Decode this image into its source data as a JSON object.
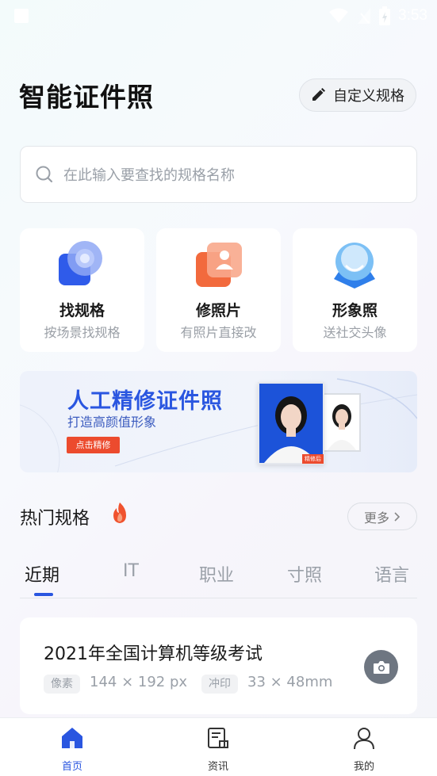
{
  "status_bar": {
    "time": "3:53"
  },
  "header": {
    "title": "智能证件照",
    "custom_button": "自定义规格"
  },
  "search": {
    "placeholder": "在此输入要查找的规格名称"
  },
  "features": [
    {
      "title": "找规格",
      "subtitle": "按场景找规格",
      "icon": "search-spec-icon"
    },
    {
      "title": "修照片",
      "subtitle": "有照片直接改",
      "icon": "edit-photo-icon"
    },
    {
      "title": "形象照",
      "subtitle": "送社交头像",
      "icon": "avatar-icon"
    }
  ],
  "banner": {
    "title": "人工精修证件照",
    "subtitle": "打造高颜值形象",
    "button": "点击精修",
    "tag": "精修后"
  },
  "hot": {
    "title": "热门规格",
    "more": "更多"
  },
  "tabs": [
    "近期",
    "IT",
    "职业",
    "寸照",
    "语言"
  ],
  "active_tab": 0,
  "spec_card": {
    "title": "2021年全国计算机等级考试",
    "pixel_label": "像素",
    "pixel_value": "144 × 192 px",
    "print_label": "冲印",
    "print_value": "33 × 48mm"
  },
  "bottom_nav": [
    {
      "label": "首页",
      "icon": "home-icon",
      "active": true
    },
    {
      "label": "资讯",
      "icon": "news-icon",
      "active": false
    },
    {
      "label": "我的",
      "icon": "user-icon",
      "active": false
    }
  ],
  "colors": {
    "accent": "#2a56e0",
    "banner_button": "#ec4b2e"
  }
}
